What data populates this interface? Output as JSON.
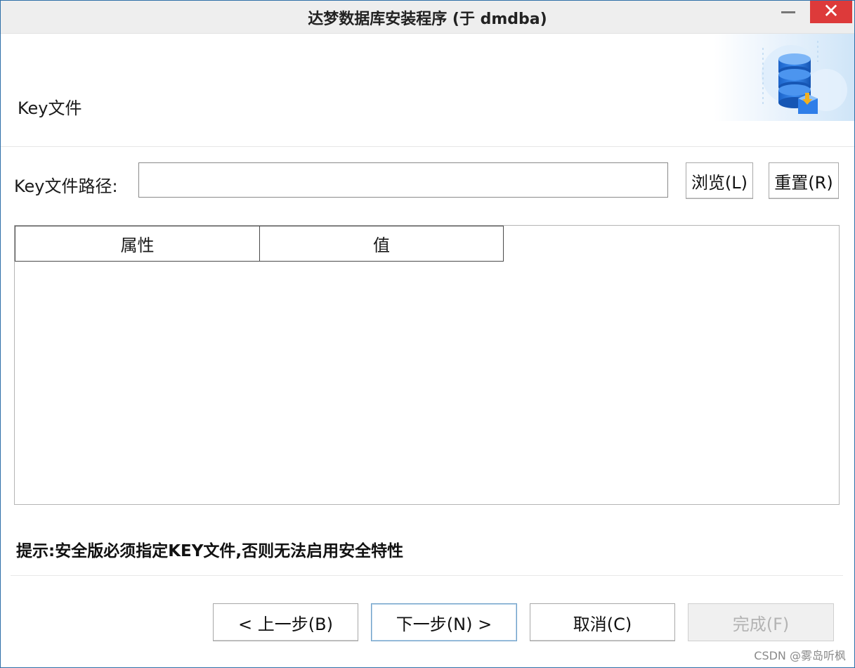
{
  "window": {
    "title": "达梦数据库安装程序 (于 dmdba)",
    "minimize_label": "—",
    "close_label": "✕"
  },
  "header": {
    "page_title": "Key文件",
    "banner_icon": "database-install-icon"
  },
  "key_file": {
    "label": "Key文件路径:",
    "value": "",
    "browse_label": "浏览(L)",
    "reset_label": "重置(R)"
  },
  "table": {
    "columns": [
      "属性",
      "值"
    ],
    "rows": []
  },
  "hint": "提示:安全版必须指定KEY文件,否则无法启用安全特性",
  "footer": {
    "back_label": "< 上一步(B)",
    "next_label": "下一步(N) >",
    "cancel_label": "取消(C)",
    "finish_label": "完成(F)"
  },
  "watermark": "CSDN @雾岛听枫",
  "colors": {
    "close_button": "#dd3a3a",
    "window_border": "#2f6fa8",
    "banner_blue": "#1e6fd9"
  }
}
